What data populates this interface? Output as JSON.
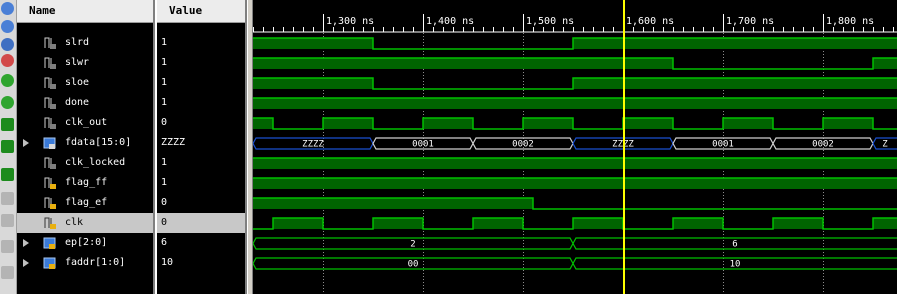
{
  "toolbar": {
    "buttons": [
      {
        "icon": "zoom-out-icon",
        "color": "#4a7fd6"
      },
      {
        "icon": "zoom-in-icon",
        "color": "#4a7fd6"
      },
      {
        "icon": "zoom-fit-icon",
        "color": "#3f6fc2"
      },
      {
        "icon": "cursor-icon",
        "color": "#d24a4a"
      },
      {
        "icon": "prev-edge-icon",
        "color": "#2fa52f"
      },
      {
        "icon": "next-edge-icon",
        "color": "#2fa52f"
      },
      {
        "icon": "go-to-time-0-icon",
        "color": "#1d8b1d"
      },
      {
        "icon": "go-to-last-icon",
        "color": "#1d8b1d"
      },
      {
        "icon": "swap-cursors-icon",
        "color": "#1d8b1d"
      },
      {
        "icon": "add-marker-icon",
        "color": "#b4b4b4"
      },
      {
        "icon": "prev-marker-icon",
        "color": "#b4b4b4"
      },
      {
        "icon": "next-marker-icon",
        "color": "#b4b4b4"
      },
      {
        "icon": "delete-markers-icon",
        "color": "#b4b4b4"
      }
    ]
  },
  "columns": {
    "name": "Name",
    "value": "Value"
  },
  "signals": [
    {
      "name": "slrd",
      "value": "1",
      "kind": "bit",
      "expandable": false,
      "selected": false
    },
    {
      "name": "slwr",
      "value": "1",
      "kind": "bit",
      "expandable": false,
      "selected": false
    },
    {
      "name": "sloe",
      "value": "1",
      "kind": "bit",
      "expandable": false,
      "selected": false
    },
    {
      "name": "done",
      "value": "1",
      "kind": "bit",
      "expandable": false,
      "selected": false
    },
    {
      "name": "clk_out",
      "value": "0",
      "kind": "bit",
      "expandable": false,
      "selected": false
    },
    {
      "name": "fdata[15:0]",
      "value": "ZZZZ",
      "kind": "bus",
      "expandable": true,
      "selected": false
    },
    {
      "name": "clk_locked",
      "value": "1",
      "kind": "bit",
      "expandable": false,
      "selected": false
    },
    {
      "name": "flag_ff",
      "value": "1",
      "kind": "bit-in",
      "expandable": false,
      "selected": false
    },
    {
      "name": "flag_ef",
      "value": "0",
      "kind": "bit-in",
      "expandable": false,
      "selected": false
    },
    {
      "name": "clk",
      "value": "0",
      "kind": "bit-in",
      "expandable": false,
      "selected": true
    },
    {
      "name": "ep[2:0]",
      "value": "6",
      "kind": "bus-in",
      "expandable": true,
      "selected": false
    },
    {
      "name": "faddr[1:0]",
      "value": "10",
      "kind": "bus-in",
      "expandable": true,
      "selected": false
    }
  ],
  "time_axis": {
    "ticks": [
      "1,300 ns",
      "1,400 ns",
      "1,500 ns",
      "1,600 ns",
      "1,700 ns",
      "1,800 ns"
    ],
    "cursor_color": "#ffff00",
    "wave_color": "#00c000",
    "fill_color": "#006400"
  },
  "waves": {
    "slrd": [
      [
        0,
        1
      ],
      [
        120,
        0
      ],
      [
        320,
        1
      ]
    ],
    "slwr": [
      [
        0,
        1
      ],
      [
        420,
        0
      ],
      [
        620,
        1
      ]
    ],
    "sloe": [
      [
        0,
        1
      ],
      [
        120,
        0
      ],
      [
        320,
        1
      ]
    ],
    "done": [
      [
        0,
        1
      ]
    ],
    "clk_out": [
      [
        0,
        1
      ],
      [
        20,
        0
      ],
      [
        70,
        1
      ],
      [
        120,
        0
      ],
      [
        170,
        1
      ],
      [
        220,
        0
      ],
      [
        270,
        1
      ],
      [
        320,
        0
      ],
      [
        370,
        1
      ],
      [
        420,
        0
      ],
      [
        470,
        1
      ],
      [
        520,
        0
      ],
      [
        570,
        1
      ],
      [
        620,
        0
      ]
    ],
    "clk_locked": [
      [
        0,
        1
      ]
    ],
    "flag_ff": [
      [
        0,
        1
      ]
    ],
    "flag_ef": [
      [
        0,
        1
      ],
      [
        280,
        0
      ]
    ],
    "clk": [
      [
        0,
        0
      ],
      [
        20,
        1
      ],
      [
        70,
        0
      ],
      [
        120,
        1
      ],
      [
        170,
        0
      ],
      [
        220,
        1
      ],
      [
        270,
        0
      ],
      [
        320,
        1
      ],
      [
        370,
        0
      ],
      [
        420,
        1
      ],
      [
        470,
        0
      ],
      [
        520,
        1
      ],
      [
        570,
        0
      ],
      [
        620,
        1
      ]
    ],
    "fdata_segments": [
      {
        "start": 0,
        "end": 120,
        "label": "ZZZZ",
        "highz": true
      },
      {
        "start": 120,
        "end": 220,
        "label": "0001",
        "highz": false
      },
      {
        "start": 220,
        "end": 320,
        "label": "0002",
        "highz": false
      },
      {
        "start": 320,
        "end": 420,
        "label": "ZZZZ",
        "highz": true
      },
      {
        "start": 420,
        "end": 520,
        "label": "0001",
        "highz": false
      },
      {
        "start": 520,
        "end": 620,
        "label": "0002",
        "highz": false
      },
      {
        "start": 620,
        "end": 650,
        "label": "Z",
        "highz": true
      }
    ],
    "ep_segments": [
      {
        "start": 0,
        "end": 320,
        "label": "2"
      },
      {
        "start": 320,
        "end": 650,
        "label": "6"
      }
    ],
    "faddr_segments": [
      {
        "start": 0,
        "end": 320,
        "label": "00"
      },
      {
        "start": 320,
        "end": 650,
        "label": "10"
      }
    ]
  }
}
